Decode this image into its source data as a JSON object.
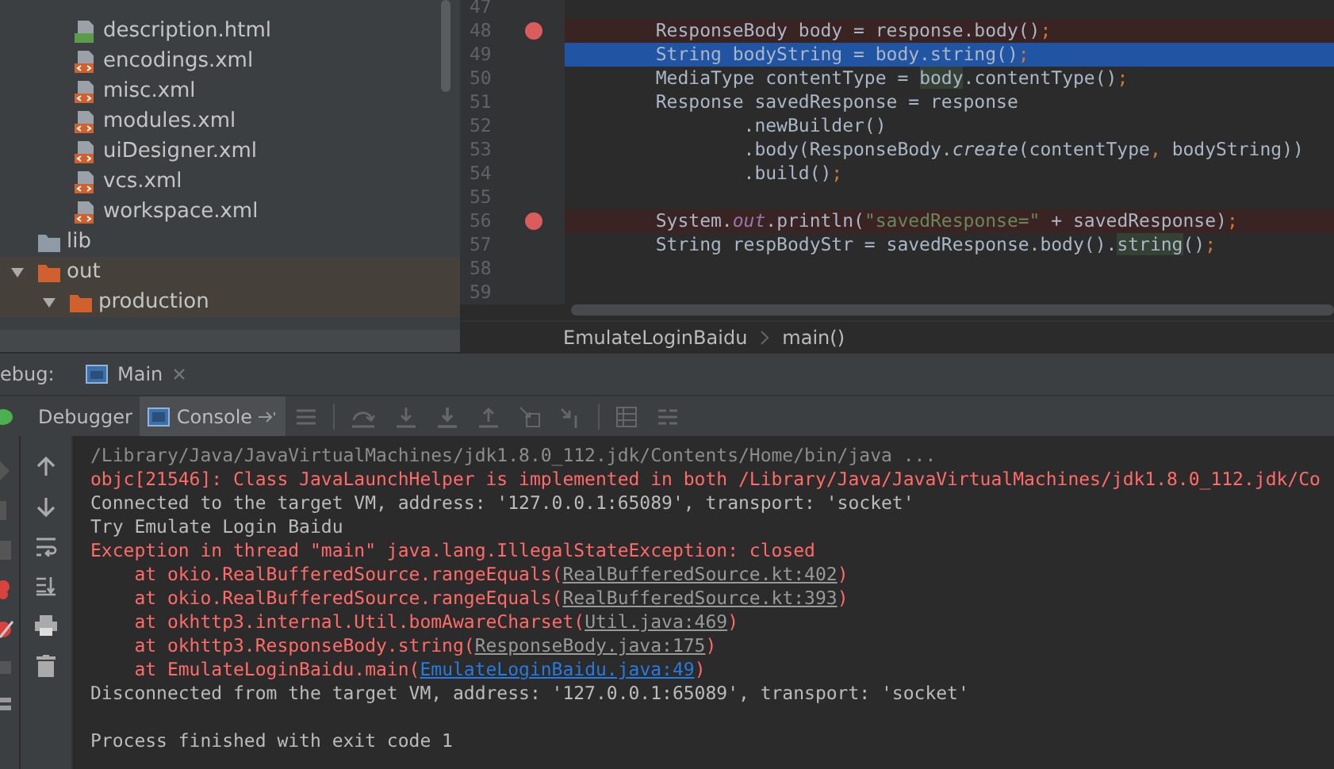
{
  "project_tree": {
    "cut_folder_children": [
      {
        "name": "description.html",
        "kind": "html"
      },
      {
        "name": "encodings.xml",
        "kind": "xml"
      },
      {
        "name": "misc.xml",
        "kind": "xml"
      },
      {
        "name": "modules.xml",
        "kind": "xml"
      },
      {
        "name": "uiDesigner.xml",
        "kind": "xml"
      },
      {
        "name": "vcs.xml",
        "kind": "xml"
      },
      {
        "name": "workspace.xml",
        "kind": "xml"
      }
    ],
    "items": [
      {
        "name": "lib",
        "kind": "library-folder"
      },
      {
        "name": "out",
        "kind": "excluded-folder",
        "expanded": true,
        "children": [
          {
            "name": "production",
            "kind": "excluded-folder",
            "expanded": true
          }
        ]
      }
    ]
  },
  "editor": {
    "lines": [
      {
        "number": "47",
        "breakpoint": false,
        "current": false
      },
      {
        "number": "48",
        "breakpoint": true,
        "current": false,
        "tokens": [
          {
            "text": "        ResponseBody body = response.body()",
            "kind": "plain"
          },
          {
            "text": ";",
            "kind": "punct"
          }
        ]
      },
      {
        "number": "49",
        "breakpoint": false,
        "current": true,
        "tokens": [
          {
            "text": "        String bodyString = body.string()",
            "kind": "plain"
          },
          {
            "text": ";",
            "kind": "punct"
          }
        ]
      },
      {
        "number": "50",
        "breakpoint": false,
        "current": false,
        "tokens": [
          {
            "text": "        MediaType contentType = ",
            "kind": "plain"
          },
          {
            "text": "body",
            "kind": "usage"
          },
          {
            "text": ".contentType()",
            "kind": "plain"
          },
          {
            "text": ";",
            "kind": "punct"
          }
        ]
      },
      {
        "number": "51",
        "breakpoint": false,
        "current": false,
        "tokens": [
          {
            "text": "        Response savedResponse = response",
            "kind": "plain"
          }
        ]
      },
      {
        "number": "52",
        "breakpoint": false,
        "current": false,
        "tokens": [
          {
            "text": "                .newBuilder()",
            "kind": "plain"
          }
        ]
      },
      {
        "number": "53",
        "breakpoint": false,
        "current": false,
        "tokens": [
          {
            "text": "                .body(ResponseBody.",
            "kind": "plain"
          },
          {
            "text": "create",
            "kind": "italic"
          },
          {
            "text": "(contentType",
            "kind": "plain"
          },
          {
            "text": ",",
            "kind": "punct"
          },
          {
            "text": " bodyString))",
            "kind": "plain"
          }
        ]
      },
      {
        "number": "54",
        "breakpoint": false,
        "current": false,
        "tokens": [
          {
            "text": "                .build()",
            "kind": "plain"
          },
          {
            "text": ";",
            "kind": "punct"
          }
        ]
      },
      {
        "number": "55",
        "breakpoint": false,
        "current": false
      },
      {
        "number": "56",
        "breakpoint": true,
        "current": false,
        "tokens": [
          {
            "text": "        System.",
            "kind": "plain"
          },
          {
            "text": "out",
            "kind": "static"
          },
          {
            "text": ".println(",
            "kind": "plain"
          },
          {
            "text": "\"savedResponse=\"",
            "kind": "string"
          },
          {
            "text": " + savedResponse)",
            "kind": "plain"
          },
          {
            "text": ";",
            "kind": "punct"
          }
        ]
      },
      {
        "number": "57",
        "breakpoint": false,
        "current": false,
        "tokens": [
          {
            "text": "        String respBodyStr = savedResponse.body().",
            "kind": "plain"
          },
          {
            "text": "string",
            "kind": "usage"
          },
          {
            "text": "()",
            "kind": "plain"
          },
          {
            "text": ";",
            "kind": "punct"
          }
        ]
      },
      {
        "number": "58",
        "breakpoint": false,
        "current": false
      },
      {
        "number": "59",
        "breakpoint": false,
        "current": false
      }
    ],
    "breadcrumbs": [
      "EmulateLoginBaidu",
      "main()"
    ]
  },
  "debug": {
    "label": "ebug:",
    "session_tab": "Main",
    "tabs": [
      {
        "label": "Debugger",
        "selected": false
      },
      {
        "label": "Console",
        "selected": true
      }
    ],
    "console": [
      {
        "kind": "command",
        "text": "/Library/Java/JavaVirtualMachines/jdk1.8.0_112.jdk/Contents/Home/bin/java ..."
      },
      {
        "kind": "error",
        "text": "objc[21546]: Class JavaLaunchHelper is implemented in both /Library/Java/JavaVirtualMachines/jdk1.8.0_112.jdk/Co"
      },
      {
        "kind": "normal",
        "text": "Connected to the target VM, address: '127.0.0.1:65089', transport: 'socket'"
      },
      {
        "kind": "normal",
        "text": "Try Emulate Login Baidu"
      },
      {
        "kind": "error",
        "text": "Exception in thread \"main\" java.lang.IllegalStateException: closed"
      },
      {
        "kind": "error",
        "text": "    at okio.RealBufferedSource.rangeEquals(",
        "link": "RealBufferedSource.kt:402",
        "in_project": false,
        "after": ")"
      },
      {
        "kind": "error",
        "text": "    at okio.RealBufferedSource.rangeEquals(",
        "link": "RealBufferedSource.kt:393",
        "in_project": false,
        "after": ")"
      },
      {
        "kind": "error",
        "text": "    at okhttp3.internal.Util.bomAwareCharset(",
        "link": "Util.java:469",
        "in_project": false,
        "after": ")"
      },
      {
        "kind": "error",
        "text": "    at okhttp3.ResponseBody.string(",
        "link": "ResponseBody.java:175",
        "in_project": false,
        "after": ")"
      },
      {
        "kind": "error",
        "text": "    at EmulateLoginBaidu.main(",
        "link": "EmulateLoginBaidu.java:49",
        "in_project": true,
        "after": ")"
      },
      {
        "kind": "normal",
        "text": "Disconnected from the target VM, address: '127.0.0.1:65089', transport: 'socket'"
      },
      {
        "kind": "blank"
      },
      {
        "kind": "normal",
        "text": "Process finished with exit code 1"
      }
    ]
  }
}
